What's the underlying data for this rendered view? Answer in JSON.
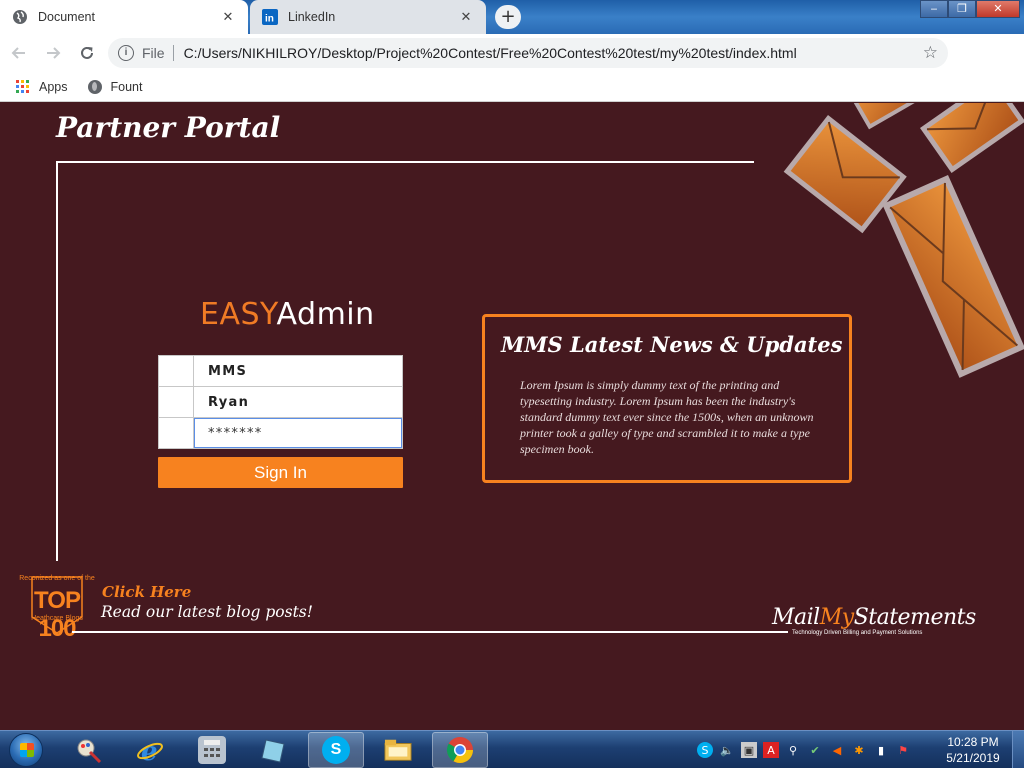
{
  "browser": {
    "tabs": [
      {
        "label": "Document",
        "active": true,
        "icon": "globe-icon"
      },
      {
        "label": "LinkedIn",
        "active": false,
        "icon": "linkedin-icon"
      }
    ],
    "new_tab_label": "+",
    "address": {
      "scheme": "File",
      "url": "C:/Users/NIKHILROY/Desktop/Project%20Contest/Free%20Contest%20test/my%20test/index.html"
    },
    "bookmarks": [
      {
        "label": "Apps",
        "icon": "apps-grid-icon"
      },
      {
        "label": "Fount",
        "icon": "globe-icon"
      }
    ]
  },
  "page": {
    "portal_title": "Partner Portal",
    "logo": {
      "easy": "EASY",
      "admin": "Admin"
    },
    "login": {
      "company_value": "MMS",
      "username_value": "Ryan",
      "password_value": "*******",
      "signin_label": "Sign In"
    },
    "news": {
      "title": "MMS Latest News & Updates",
      "body": "Lorem Ipsum is simply dummy text of the printing and typesetting industry. Lorem Ipsum has been the industry's standard dummy text ever since the 1500s, when an unknown printer took a galley of type and scrambled it to make a type specimen book."
    },
    "badge": {
      "line1": "Reconized as one of the",
      "line2": "TOP 100",
      "line3": "Heathcare Blogs"
    },
    "blog": {
      "click_here": "Click Here",
      "text": "Read our latest blog posts!"
    },
    "brand": {
      "mail": "Mail",
      "my": "My",
      "statements": "Statements",
      "tagline": "Technology Driven    Billing and Payment Solutions"
    },
    "colors": {
      "background": "#45191f",
      "accent": "#f7821f",
      "text": "#ffffff"
    }
  },
  "taskbar": {
    "apps": [
      "paint-icon",
      "internet-explorer-icon",
      "calculator-icon",
      "notepad-icon",
      "skype-icon",
      "file-explorer-icon",
      "chrome-icon"
    ],
    "clock_time": "10:28 PM",
    "clock_date": "5/21/2019"
  }
}
